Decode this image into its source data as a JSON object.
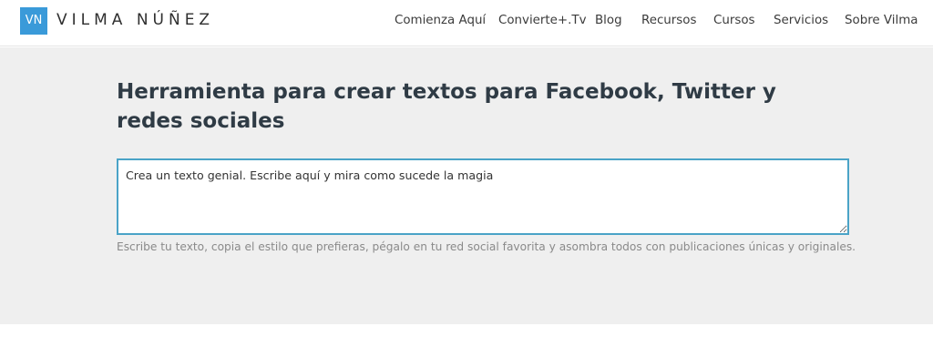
{
  "header": {
    "logo_mark": "VN",
    "logo_name": "VILMA NÚÑEZ",
    "nav": [
      {
        "label": "Comienza Aquí"
      },
      {
        "label": "Convierte+.Tv"
      },
      {
        "label": "Blog"
      },
      {
        "label": "Recursos"
      },
      {
        "label": "Cursos"
      },
      {
        "label": "Servicios"
      },
      {
        "label": "Sobre Vilma"
      }
    ]
  },
  "main": {
    "title": "Herramienta para crear textos para Facebook, Twitter y redes sociales",
    "textarea": {
      "value": "Crea un texto genial. Escribe aquí y mira como sucede la magia"
    },
    "help_text": "Escribe tu texto, copia el estilo que prefieras, pégalo en tu red social favorita y asombra todos con publicaciones únicas y originales."
  },
  "colors": {
    "logo_bg": "#3a9ad9",
    "textarea_border": "#4aa3c7",
    "content_bg": "#efefef",
    "title_color": "#2f3b45"
  }
}
